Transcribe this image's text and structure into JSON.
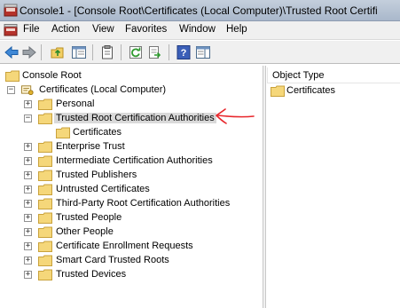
{
  "window": {
    "title": "Console1 - [Console Root\\Certificates (Local Computer)\\Trusted Root Certifi"
  },
  "menu": {
    "items": [
      "File",
      "Action",
      "View",
      "Favorites",
      "Window",
      "Help"
    ]
  },
  "toolbar": {
    "icons": [
      "back-arrow-icon",
      "forward-arrow-icon",
      "up-folder-icon",
      "show-hide-tree-icon",
      "clipboard-icon",
      "refresh-icon",
      "export-list-icon",
      "help-icon",
      "action-pane-icon"
    ]
  },
  "tree": {
    "root": "Console Root",
    "store": "Certificates (Local Computer)",
    "items": [
      "Personal",
      "Trusted Root Certification Authorities",
      "Certificates",
      "Enterprise Trust",
      "Intermediate Certification Authorities",
      "Trusted Publishers",
      "Untrusted Certificates",
      "Third-Party Root Certification Authorities",
      "Trusted People",
      "Other People",
      "Certificate Enrollment Requests",
      "Smart Card Trusted Roots",
      "Trusted Devices"
    ],
    "selected": "Trusted Root Certification Authorities"
  },
  "details": {
    "column_header": "Object Type",
    "rows": [
      "Certificates"
    ]
  },
  "colors": {
    "annotation_arrow": "#e8262b",
    "folder_fill": "#f5d77a",
    "selection": "#d9d9d9"
  }
}
